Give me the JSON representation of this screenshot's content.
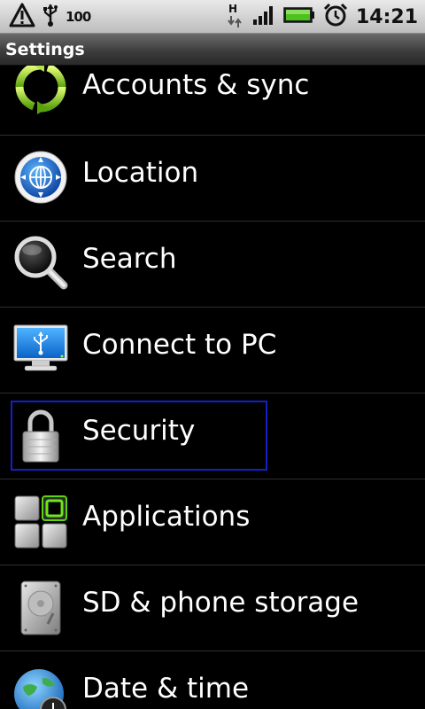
{
  "status_bar": {
    "battery_percent_text": "100",
    "network_type": "H",
    "time": "14:21",
    "icons": [
      "warning-icon",
      "usb-icon",
      "data-activity-icon",
      "signal-strength-icon",
      "battery-icon",
      "alarm-clock-icon"
    ]
  },
  "title_bar": {
    "title": "Settings"
  },
  "settings_list": {
    "focused_item": "Security",
    "items": [
      {
        "label": "Accounts & sync",
        "icon": "sync-arrows-icon"
      },
      {
        "label": "Location",
        "icon": "globe-compass-icon"
      },
      {
        "label": "Search",
        "icon": "magnifier-icon"
      },
      {
        "label": "Connect to PC",
        "icon": "monitor-usb-icon"
      },
      {
        "label": "Security",
        "icon": "padlock-icon"
      },
      {
        "label": "Applications",
        "icon": "app-grid-icon"
      },
      {
        "label": "SD & phone storage",
        "icon": "hard-drive-icon"
      },
      {
        "label": "Date & time",
        "icon": "globe-clock-icon"
      }
    ]
  },
  "colors": {
    "background": "#000000",
    "focus_border": "#1620c8",
    "divider": "#2e2e2e",
    "battery_fill": "#4cc21c"
  }
}
